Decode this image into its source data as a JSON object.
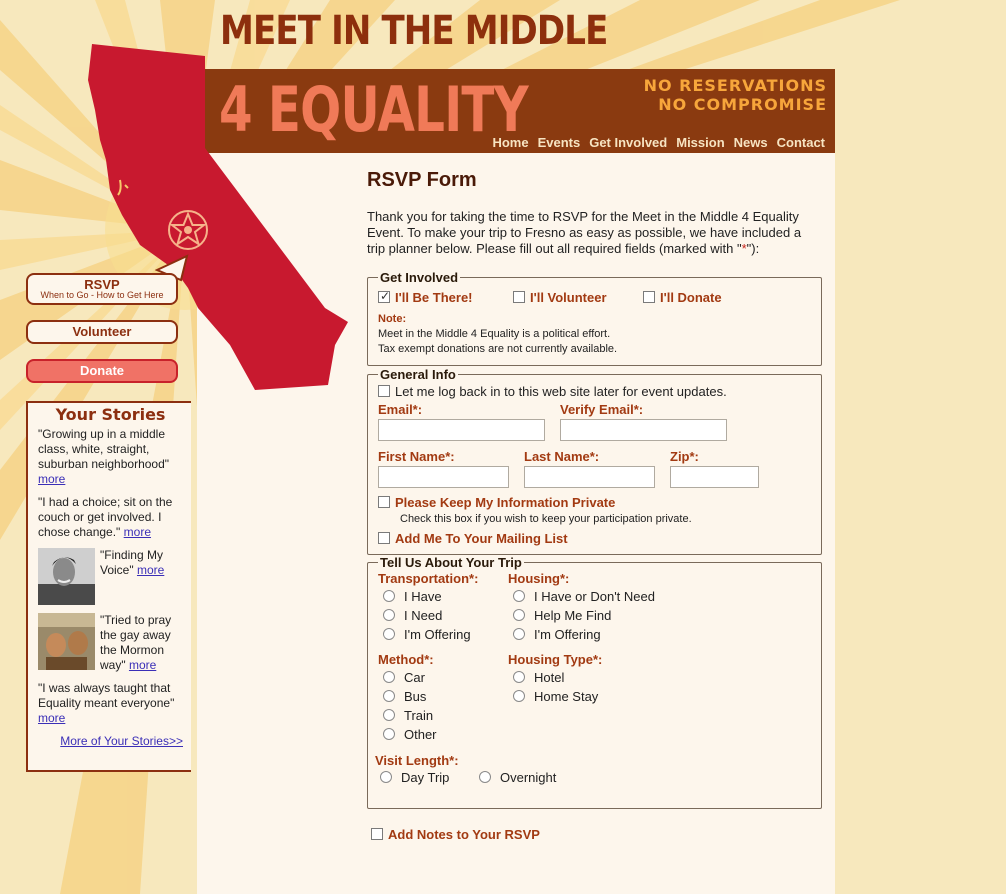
{
  "site": {
    "title_line1": "MEET IN THE MIDDLE",
    "title_line2": "4 EQUALITY",
    "tagline1": "NO RESERVATIONS",
    "tagline2": "NO COMPROMISE"
  },
  "nav": [
    "Home",
    "Events",
    "Get Involved",
    "Mission",
    "News",
    "Contact"
  ],
  "sidebar": {
    "rsvp_label": "RSVP",
    "rsvp_sub": "When to Go - How to Get Here",
    "volunteer_label": "Volunteer",
    "donate_label": "Donate",
    "stories_title": "Your Stories",
    "stories": [
      {
        "quote": "\"Growing up in a middle class, white, straight, suburban neighborhood\"",
        "more": "more"
      },
      {
        "quote": "\"I had a choice; sit on the couch or get involved. I chose change.\"",
        "more": "more"
      },
      {
        "quote": "\"Finding My Voice\"",
        "more": "more"
      },
      {
        "quote": "\"Tried to pray the gay away the Mormon way\"",
        "more": "more"
      },
      {
        "quote": "\"I was always taught that Equality meant everyone\"",
        "more": "more"
      }
    ],
    "more_stories": "More of Your Stories>>"
  },
  "form": {
    "title": "RSVP Form",
    "intro": "Thank you for taking the time to RSVP for the Meet in the Middle 4 Equality Event. To make your trip to Fresno as easy as possible, we have included a trip planner below. Please fill out all required fields (marked with \"",
    "intro_star": "*",
    "intro_end": "\"):",
    "get_involved": {
      "legend": "Get Involved",
      "options": [
        {
          "label": "I'll Be There!",
          "checked": true
        },
        {
          "label": "I'll Volunteer",
          "checked": false
        },
        {
          "label": "I'll Donate",
          "checked": false
        }
      ],
      "note_label": "Note:",
      "note_line1": "Meet in the Middle 4 Equality is a political effort.",
      "note_line2": "Tax exempt donations are not currently available."
    },
    "general": {
      "legend": "General Info",
      "login_label": "Let me log back in to this web site later for event updates.",
      "email_label": "Email*:",
      "verify_email_label": "Verify Email*:",
      "first_name_label": "First Name*:",
      "last_name_label": "Last Name*:",
      "zip_label": "Zip*:",
      "email_value": "",
      "verify_email_value": "",
      "first_name_value": "",
      "last_name_value": "",
      "zip_value": "",
      "private_label": "Please Keep My Information Private",
      "private_help": "Check this box if you wish to keep your participation private.",
      "mailing_label": "Add Me To Your Mailing List"
    },
    "trip": {
      "legend": "Tell Us About Your Trip",
      "transportation_label": "Transportation*:",
      "transportation_options": [
        "I Have",
        "I Need",
        "I'm Offering"
      ],
      "housing_label": "Housing*:",
      "housing_options": [
        "I Have or Don't Need",
        "Help Me Find",
        "I'm Offering"
      ],
      "method_label": "Method*:",
      "method_options": [
        "Car",
        "Bus",
        "Train",
        "Other"
      ],
      "housing_type_label": "Housing Type*:",
      "housing_type_options": [
        "Hotel",
        "Home Stay"
      ],
      "visit_length_label": "Visit Length*:",
      "visit_length_options": [
        "Day Trip",
        "Overnight"
      ]
    },
    "notes_label": "Add Notes to Your RSVP"
  },
  "colors": {
    "background": "#f7e8bd",
    "banner": "#8a3a10",
    "accent_red": "#c8192f",
    "label_brown": "#a23a12",
    "content_bg": "#fdf6ec"
  }
}
